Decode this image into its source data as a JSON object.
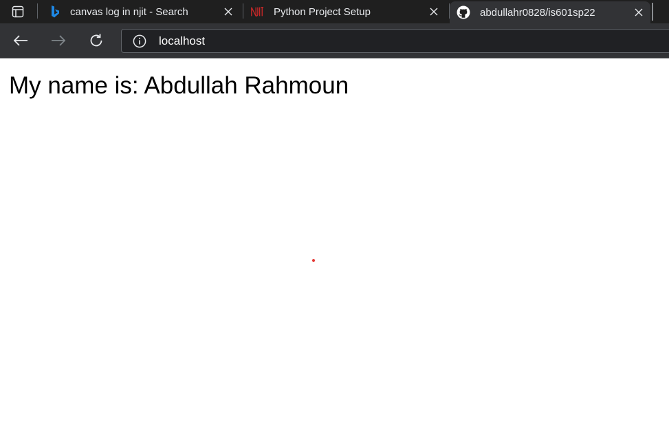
{
  "tabs": [
    {
      "label": "canvas log in njit - Search",
      "icon": "bing-icon",
      "active": false
    },
    {
      "label": "Python Project Setup",
      "icon": "njit-icon",
      "active": false
    },
    {
      "label": "abdullahr0828/is601sp22",
      "icon": "github-icon",
      "active": true
    }
  ],
  "address_bar": {
    "url": "localhost"
  },
  "page": {
    "heading": "My name is: Abdullah Rahmoun"
  },
  "colors": {
    "chrome_bg": "#202124",
    "tab_strip_bg": "#1f1f1f",
    "toolbar_bg": "#323336",
    "text_light": "#e8eaed",
    "bing_blue": "#1e88e5",
    "njit_red": "#c62828",
    "cursor_dot": "#e53935"
  }
}
